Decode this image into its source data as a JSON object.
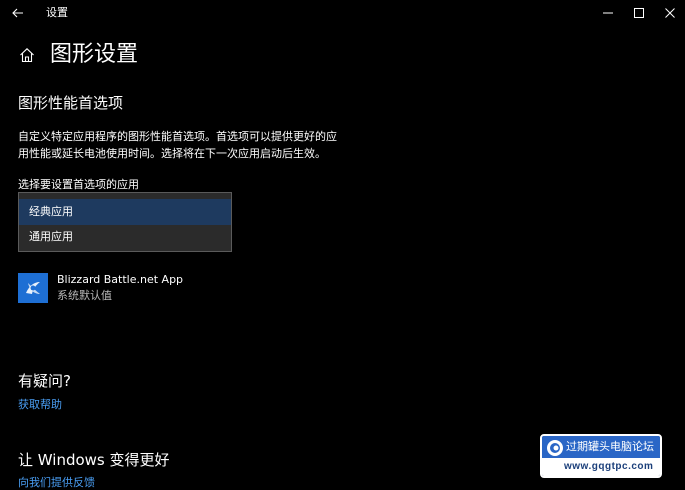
{
  "window": {
    "title": "设置"
  },
  "header": {
    "page_title": "图形设置"
  },
  "graphics": {
    "section_title": "图形性能首选项",
    "description_line1": "自定义特定应用程序的图形性能首选项。首选项可以提供更好的应",
    "description_line2": "用性能或延长电池使用时间。选择将在下一次应用启动后生效。",
    "select_label": "选择要设置首选项的应用",
    "dropdown": {
      "options": [
        "经典应用",
        "通用应用"
      ],
      "selected": "经典应用"
    }
  },
  "app_list": [
    {
      "name": "Blizzard Battle.net App",
      "preference": "系统默认值"
    }
  ],
  "help": {
    "title": "有疑问?",
    "link": "获取帮助"
  },
  "improve": {
    "title": "让 Windows 变得更好",
    "link": "向我们提供反馈"
  },
  "watermark": {
    "name": "过期罐头电脑论坛",
    "url": "www.gqgtpc.com"
  },
  "colors": {
    "background": "#000000",
    "accent_link": "#4a9ff5",
    "selected_option": "#1e3a5f",
    "app_icon": "#1e6fd4"
  }
}
